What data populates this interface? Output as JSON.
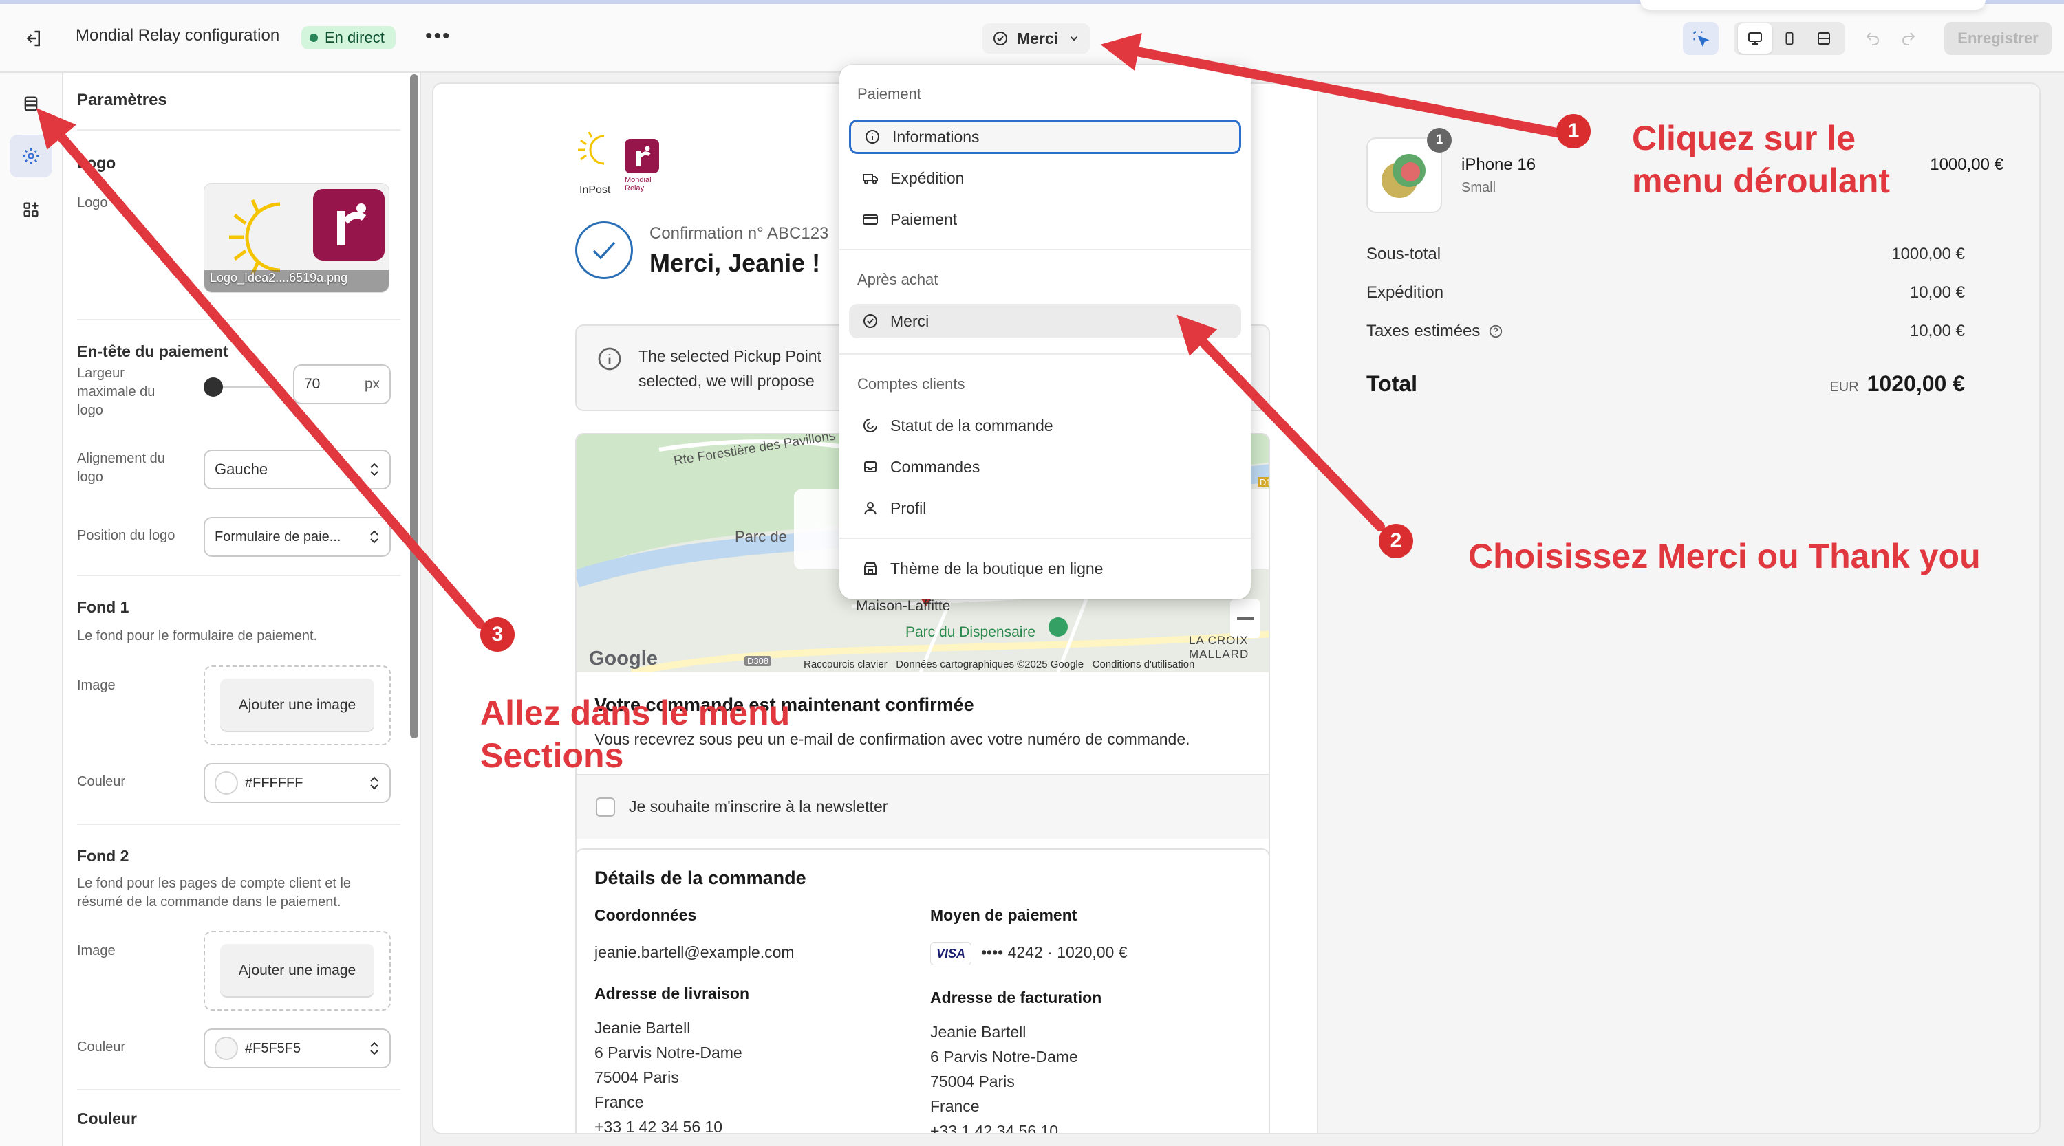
{
  "topbar": {
    "app_title": "Mondial Relay configuration",
    "live_badge": "En direct",
    "more": "•••",
    "page_selector": "Merci",
    "save": "Enregistrer"
  },
  "settings": {
    "title": "Paramètres",
    "logo": {
      "section": "Logo",
      "label": "Logo",
      "filename": "Logo_Idea2....6519a.png"
    },
    "header": {
      "section": "En-tête du paiement",
      "max_width_label": "Largeur maximale du logo",
      "max_width_value": "70",
      "max_width_unit": "px",
      "align_label": "Alignement du logo",
      "align_value": "Gauche",
      "position_label": "Position du logo",
      "position_value": "Formulaire de paie..."
    },
    "bg1": {
      "section": "Fond 1",
      "desc": "Le fond pour le formulaire de paiement.",
      "image_label": "Image",
      "add_image": "Ajouter une image",
      "color_label": "Couleur",
      "color_value": "#FFFFFF"
    },
    "bg2": {
      "section": "Fond 2",
      "desc": "Le fond pour les pages de compte client et le résumé de la commande dans le paiement.",
      "image_label": "Image",
      "add_image": "Ajouter une image",
      "color_label": "Couleur",
      "color_value": "#F5F5F5"
    },
    "color_section": "Couleur"
  },
  "preview": {
    "logo_inpost": "InPost",
    "logo_mondial": "Mondial Relay",
    "confirmation": "Confirmation n° ABC123",
    "thanks": "Merci, Jeanie !",
    "info_line1": "The selected Pickup Point",
    "info_line2": "selected, we will propose",
    "map": {
      "road": "Rte Forestière des Pavillons",
      "parc": "Parc de",
      "place1": "Maison-Laffitte",
      "place2": "Parc du Dispensaire",
      "place3": "LA CROIX MALLARD",
      "road_d308": "D308",
      "road_d1": "D1",
      "google": "Google",
      "footer": "Raccourcis clavier   Données cartographiques ©2025 Google   Conditions d'utilisation"
    },
    "confirmed_title": "Votre commande est maintenant confirmée",
    "confirmed_text": "Vous recevrez sous peu un e-mail de confirmation avec votre numéro de commande.",
    "newsletter": "Je souhaite m'inscrire à la newsletter",
    "details": {
      "title": "Détails de la commande",
      "contact_h": "Coordonnées",
      "email": "jeanie.bartell@example.com",
      "payment_h": "Moyen de paiement",
      "visa": "VISA",
      "payment": "•••• 4242 · 1020,00 €",
      "ship_h": "Adresse de livraison",
      "bill_h": "Adresse de facturation",
      "address": [
        "Jeanie Bartell",
        "6 Parvis Notre-Dame",
        "75004 Paris",
        "France",
        "+33 1 42 34 56 10"
      ]
    },
    "summary": {
      "qty": "1",
      "product": "iPhone 16",
      "variant": "Small",
      "price": "1000,00 €",
      "subtotal_k": "Sous-total",
      "subtotal_v": "1000,00 €",
      "shipping_k": "Expédition",
      "shipping_v": "10,00 €",
      "tax_k": "Taxes estimées",
      "tax_v": "10,00 €",
      "total_k": "Total",
      "currency": "EUR",
      "total_v": "1020,00 €"
    }
  },
  "dropdown": {
    "group_payment": "Paiement",
    "informations": "Informations",
    "shipping": "Expédition",
    "payment": "Paiement",
    "group_after": "Après achat",
    "thanks": "Merci",
    "group_accounts": "Comptes clients",
    "order_status": "Statut de la commande",
    "orders": "Commandes",
    "profile": "Profil",
    "theme": "Thème de la boutique en ligne"
  },
  "annotations": {
    "n1": "1",
    "t1a": "Cliquez sur le",
    "t1b": "menu déroulant",
    "n2": "2",
    "t2": "Choisissez Merci ou Thank you",
    "n3": "3",
    "t3a": "Allez dans le menu",
    "t3b": "Sections"
  },
  "colors": {
    "annotation_red": "#e0383e",
    "live_green": "#29845a",
    "focus_blue": "#2c6ecb",
    "mondial_red": "#96154a"
  }
}
